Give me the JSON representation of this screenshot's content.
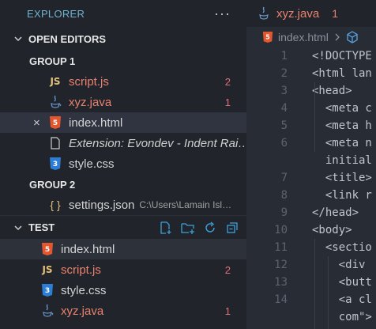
{
  "sidebar": {
    "title": "EXPLORER",
    "more": "···",
    "open_editors": {
      "label": "OPEN EDITORS",
      "groups": [
        {
          "label": "GROUP 1",
          "items": [
            {
              "label": "script.js",
              "icon": "js-icon",
              "badge": "2",
              "status": "error"
            },
            {
              "label": "xyz.java",
              "icon": "java-icon",
              "badge": "1",
              "status": "error"
            },
            {
              "label": "index.html",
              "icon": "html-icon",
              "active": true,
              "close": "×"
            },
            {
              "label": "Extension: Evondev - Indent Rai…",
              "icon": "file-icon",
              "italic": true
            },
            {
              "label": "style.css",
              "icon": "css-icon"
            }
          ]
        },
        {
          "label": "GROUP 2",
          "items": [
            {
              "label": "settings.json",
              "icon": "json-icon",
              "path": "C:\\Users\\Lamain Isl…"
            }
          ]
        }
      ]
    },
    "test": {
      "label": "TEST",
      "items": [
        {
          "label": "index.html",
          "icon": "html-icon",
          "selected": true
        },
        {
          "label": "script.js",
          "icon": "js-icon",
          "badge": "2",
          "status": "error"
        },
        {
          "label": "style.css",
          "icon": "css-icon"
        },
        {
          "label": "xyz.java",
          "icon": "java-icon",
          "badge": "1",
          "status": "error"
        }
      ]
    }
  },
  "editor": {
    "tab": {
      "label": "xyz.java",
      "badge": "1"
    },
    "breadcrumb": {
      "file": "index.html"
    },
    "lines": [
      {
        "n": "1",
        "text": "<!DOCTYPE"
      },
      {
        "n": "2",
        "text": "<html lan"
      },
      {
        "n": "3",
        "text": "<head>"
      },
      {
        "n": "4",
        "text": "  <meta c"
      },
      {
        "n": "5",
        "text": "  <meta h"
      },
      {
        "n": "6",
        "text": "  <meta n"
      },
      {
        "n": "",
        "text": "  initial"
      },
      {
        "n": "7",
        "text": "  <title>"
      },
      {
        "n": "8",
        "text": "  <link r"
      },
      {
        "n": "9",
        "text": "</head>"
      },
      {
        "n": "10",
        "text": "<body>"
      },
      {
        "n": "11",
        "text": "  <sectio"
      },
      {
        "n": "12",
        "text": "    <div"
      },
      {
        "n": "13",
        "text": "    <butt"
      },
      {
        "n": "14",
        "text": "    <a cl"
      },
      {
        "n": "",
        "text": "    com\">"
      }
    ]
  },
  "colors": {
    "accent": "#6fb3d2",
    "error": "#e8826f",
    "sidebar_bg": "#21252b",
    "editor_bg": "#282c34"
  }
}
